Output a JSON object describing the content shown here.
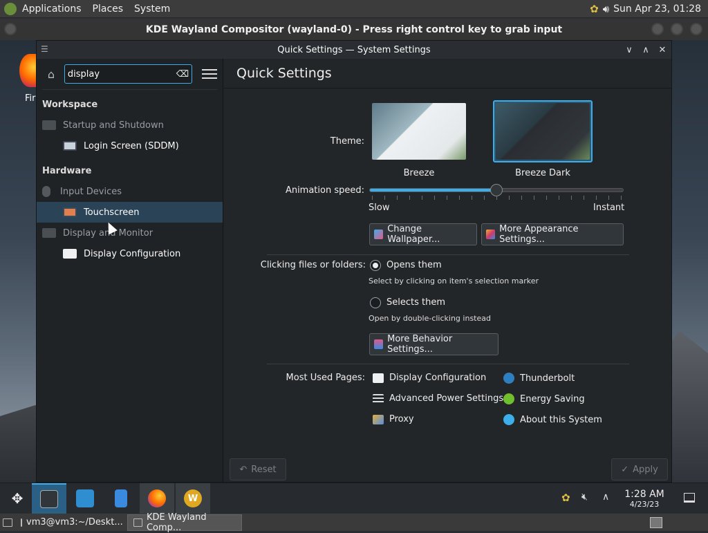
{
  "topbar": {
    "menus": [
      "Applications",
      "Places",
      "System"
    ],
    "clock": "Sun Apr 23, 01:28"
  },
  "vm": {
    "title": "KDE Wayland Compositor (wayland-0) - Press right control key to grab input"
  },
  "desktop": {
    "icon_label": "Fir"
  },
  "window": {
    "title": "Quick Settings — System Settings"
  },
  "sidebar": {
    "search_value": "display",
    "categories": [
      {
        "label": "Workspace",
        "items": [
          {
            "label": "Startup and Shutdown",
            "icon": "monitor-icon",
            "level": 1
          },
          {
            "label": "Login Screen (SDDM)",
            "icon": "login-screen-icon",
            "level": 2
          }
        ]
      },
      {
        "label": "Hardware",
        "items": [
          {
            "label": "Input Devices",
            "icon": "mouse-icon",
            "level": 1
          },
          {
            "label": "Touchscreen",
            "icon": "touchscreen-icon",
            "level": 2,
            "selected": true
          },
          {
            "label": "Display and Monitor",
            "icon": "monitor-icon",
            "level": 1
          },
          {
            "label": "Display Configuration",
            "icon": "display-icon",
            "level": 2
          }
        ]
      }
    ]
  },
  "main": {
    "heading": "Quick Settings",
    "theme_label": "Theme:",
    "themes": [
      {
        "name": "Breeze",
        "selected": false
      },
      {
        "name": "Breeze Dark",
        "selected": true
      }
    ],
    "animation_label": "Animation speed:",
    "animation_value": 0.5,
    "animation_min_label": "Slow",
    "animation_max_label": "Instant",
    "change_wallpaper": "Change Wallpaper...",
    "more_appearance": "More Appearance Settings...",
    "clicking_label": "Clicking files or folders:",
    "opens_label": "Opens them",
    "opens_hint": "Select by clicking on item's selection marker",
    "selects_label": "Selects them",
    "selects_hint": "Open by double-clicking instead",
    "more_behavior": "More Behavior Settings...",
    "most_used_label": "Most Used Pages:",
    "most_used_left": [
      {
        "label": "Display Configuration",
        "icon": "display-icon"
      },
      {
        "label": "Advanced Power Settings",
        "icon": "menu-lines-icon"
      },
      {
        "label": "Proxy",
        "icon": "proxy-icon"
      }
    ],
    "most_used_right": [
      {
        "label": "Thunderbolt",
        "icon": "thunderbolt-icon"
      },
      {
        "label": "Energy Saving",
        "icon": "energy-icon"
      },
      {
        "label": "About this System",
        "icon": "info-icon"
      }
    ],
    "reset": "Reset",
    "apply": "Apply"
  },
  "panel": {
    "time": "1:28 AM",
    "date": "4/23/23"
  },
  "taskbar": {
    "items": [
      "vm3@vm3:~/Deskt...",
      "KDE Wayland Comp..."
    ]
  },
  "colors": {
    "accent": "#3daee9",
    "selection": "#2b4356"
  }
}
